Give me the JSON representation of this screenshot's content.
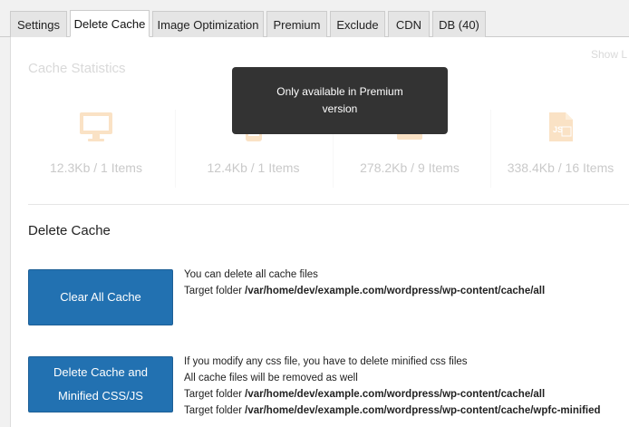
{
  "tabs": [
    {
      "label": "Settings"
    },
    {
      "label": "Delete Cache"
    },
    {
      "label": "Image Optimization"
    },
    {
      "label": "Premium"
    },
    {
      "label": "Exclude"
    },
    {
      "label": "CDN"
    },
    {
      "label": "DB (40)"
    }
  ],
  "active_tab": "Delete Cache",
  "stats": {
    "title": "Cache Statistics",
    "show_link": "Show L",
    "items": [
      {
        "icon": "desktop-icon",
        "value": "12.3Kb / 1 Items"
      },
      {
        "icon": "mobile-icon",
        "value": "12.4Kb / 1 Items"
      },
      {
        "icon": "css-file-icon",
        "value": "278.2Kb / 9 Items"
      },
      {
        "icon": "js-file-icon",
        "value": "338.4Kb / 16 Items"
      }
    ]
  },
  "tooltip": {
    "line1": "Only available in Premium",
    "line2": "version"
  },
  "delete_cache": {
    "title": "Delete Cache",
    "clear_all": {
      "button_label": "Clear All Cache",
      "line1": "You can delete all cache files",
      "target_label": "Target folder",
      "target_path": "/var/home/dev/example.com/wordpress/wp-content/cache/all"
    },
    "minified": {
      "button_line1": "Delete Cache and",
      "button_line2": "Minified CSS/JS",
      "line1": "If you modify any css file, you have to delete minified css files",
      "line2": "All cache files will be removed as well",
      "target_label_1": "Target folder",
      "target_path_1": "/var/home/dev/example.com/wordpress/wp-content/cache/all",
      "target_label_2": "Target folder",
      "target_path_2": "/var/home/dev/example.com/wordpress/wp-content/cache/wpfc-minified"
    }
  },
  "colors": {
    "accent": "#2271b1",
    "icon_orange": "#f0a54a",
    "tooltip_bg": "#333333"
  }
}
